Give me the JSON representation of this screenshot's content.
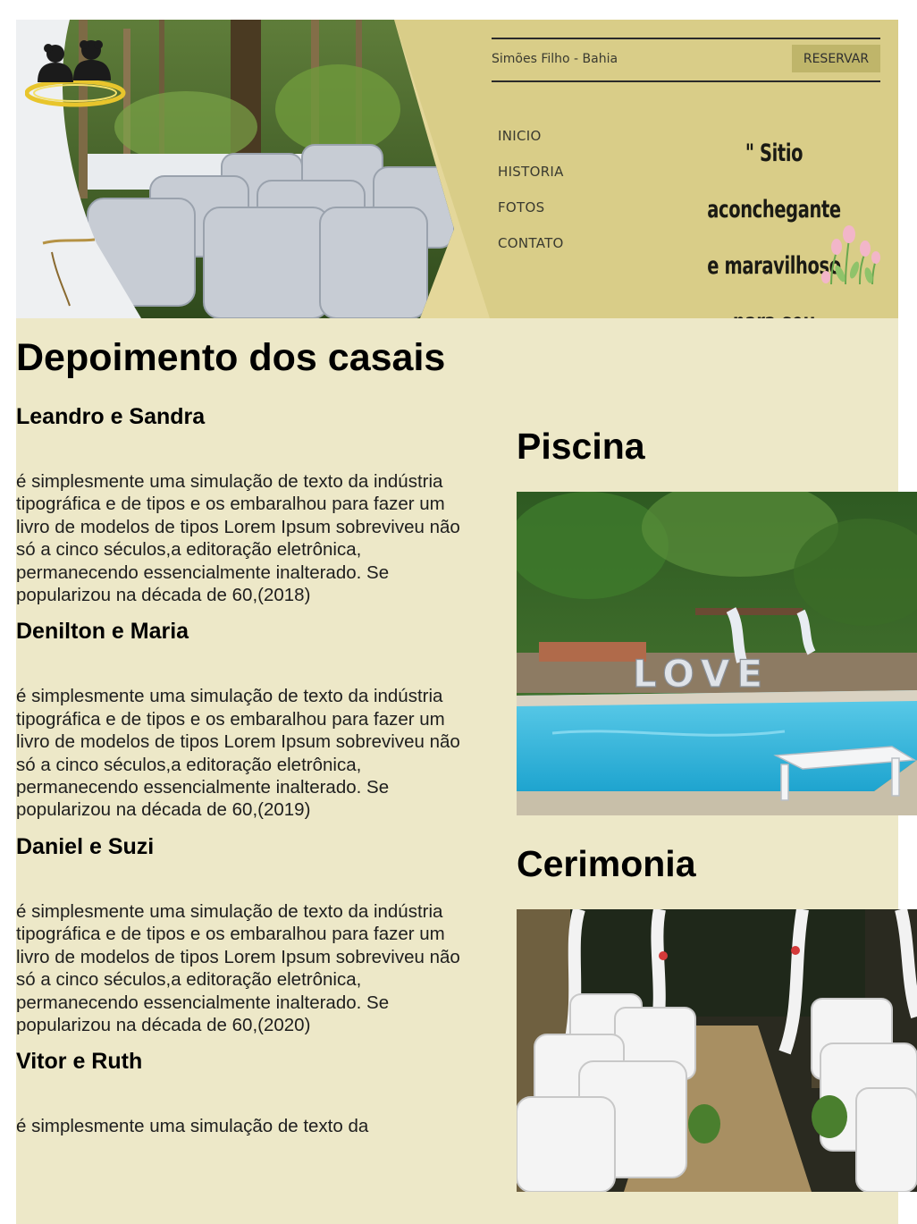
{
  "header": {
    "location": "Simões Filho - Bahia",
    "reserve_label": "RESERVAR",
    "tagline": "\" Sitio aconchegante e maravilhoso para seu evento \"",
    "nav": [
      {
        "label": "INICIO"
      },
      {
        "label": "HISTORIA"
      },
      {
        "label": "FOTOS"
      },
      {
        "label": "CONTATO"
      }
    ]
  },
  "testimonials": {
    "title": "Depoimento dos casais",
    "items": [
      {
        "names": "Leandro e Sandra",
        "text": "é simplesmente uma simulação de texto da indústria tipográfica e de tipos e os embaralhou para fazer um livro de modelos de tipos Lorem Ipsum sobreviveu não só a cinco séculos,a editoração eletrônica, permanecendo essencialmente inalterado. Se popularizou na década de 60,(2018)"
      },
      {
        "names": "Denilton e Maria",
        "text": "é simplesmente uma simulação de texto da indústria tipográfica e de tipos e os embaralhou para fazer um livro de modelos de tipos Lorem Ipsum sobreviveu não só a cinco séculos,a editoração eletrônica, permanecendo essencialmente inalterado. Se popularizou na década de 60,(2019)"
      },
      {
        "names": "Daniel e Suzi",
        "text": "é simplesmente uma simulação de texto da indústria tipográfica e de tipos e os embaralhou para fazer um livro de modelos de tipos Lorem Ipsum sobreviveu não só a cinco séculos,a editoração eletrônica, permanecendo essencialmente inalterado. Se popularizou na década de 60,(2020)"
      },
      {
        "names": "Vitor e Ruth",
        "text": "é simplesmente uma simulação de texto da"
      }
    ]
  },
  "gallery": {
    "pool": {
      "title": "Piscina",
      "sign_text": "LOVE"
    },
    "ceremony": {
      "title": "Cerimonia"
    }
  },
  "colors": {
    "page_background": "#ede8c8",
    "header_gold": "#d9cd88",
    "button_gold": "#bfb56a",
    "pool_blue": "#2fb4dc"
  }
}
